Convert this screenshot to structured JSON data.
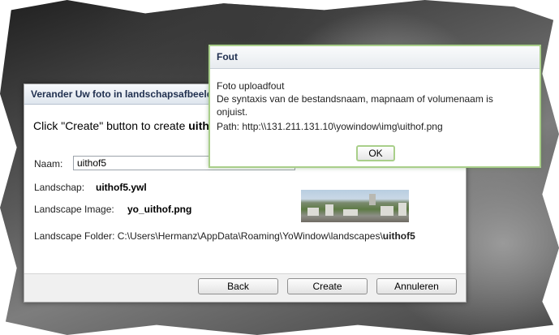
{
  "main_dialog": {
    "title": "Verander Uw foto in landschapsafbeelding",
    "headline_prefix": "Click \"Create\" button to create ",
    "headline_bold": "uithof5",
    "name_label": "Naam:",
    "name_value": "uithof5",
    "landscape_label": "Landschap:",
    "landscape_value": "uithof5.ywl",
    "image_label": "Landscape Image:",
    "image_value": "yo_uithof.png",
    "folder_label": "Landscape Folder: ",
    "folder_path": "C:\\Users\\Hermanz\\AppData\\Roaming\\YoWindow\\landscapes\\",
    "folder_bold": "uithof5",
    "buttons": {
      "back": "Back",
      "create": "Create",
      "cancel": "Annuleren"
    }
  },
  "error_dialog": {
    "title": "Fout",
    "line1": "Foto uploadfout",
    "line2": "De syntaxis van de bestandsnaam, mapnaam of volumenaam is",
    "line3": "onjuist.",
    "line4": "Path: http:\\\\131.211.131.10\\yowindow\\img\\uithof.png",
    "ok": "OK"
  },
  "colors": {
    "error_accent": "#a9cf8a",
    "title_text": "#1f2f4f"
  }
}
